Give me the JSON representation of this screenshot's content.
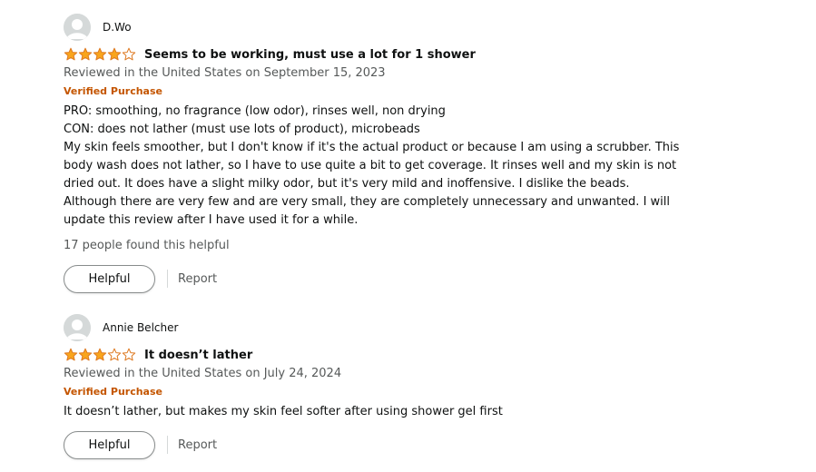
{
  "colors": {
    "star_fill": "#f9a51c",
    "star_outline": "#de7921",
    "verified": "#c45500",
    "muted_text": "#565959",
    "avatar_bg": "#d5d9d9"
  },
  "reviews": [
    {
      "reviewer": "D.Wo",
      "rating": 4,
      "rating_max": 5,
      "title": "Seems to be working, must use a lot for 1 shower",
      "date_line": "Reviewed in the United States on September 15, 2023",
      "verified": "Verified Purchase",
      "body": [
        "PRO: smoothing, no fragrance (low odor), rinses well, non drying",
        "CON: does not lather (must use lots of product), microbeads",
        "My skin feels smoother, but I don't know if it's the actual product or because I am using a scrubber. This body wash does not lather, so I have to use quite a bit to get coverage. It rinses well and my skin is not dried out. It does have a slight milky odor, but it's very mild and inoffensive. I dislike the beads. Although there are very few and are very small, they are completely unnecessary and unwanted. I will update this review after I have used it for a while."
      ],
      "helpful_count": "17 people found this helpful",
      "helpful_label": "Helpful",
      "report_label": "Report"
    },
    {
      "reviewer": "Annie Belcher",
      "rating": 3,
      "rating_max": 5,
      "title": "It doesn’t lather",
      "date_line": "Reviewed in the United States on July 24, 2024",
      "verified": "Verified Purchase",
      "body": [
        "It doesn’t lather, but makes my skin feel softer after using shower gel first"
      ],
      "helpful_label": "Helpful",
      "report_label": "Report"
    }
  ]
}
